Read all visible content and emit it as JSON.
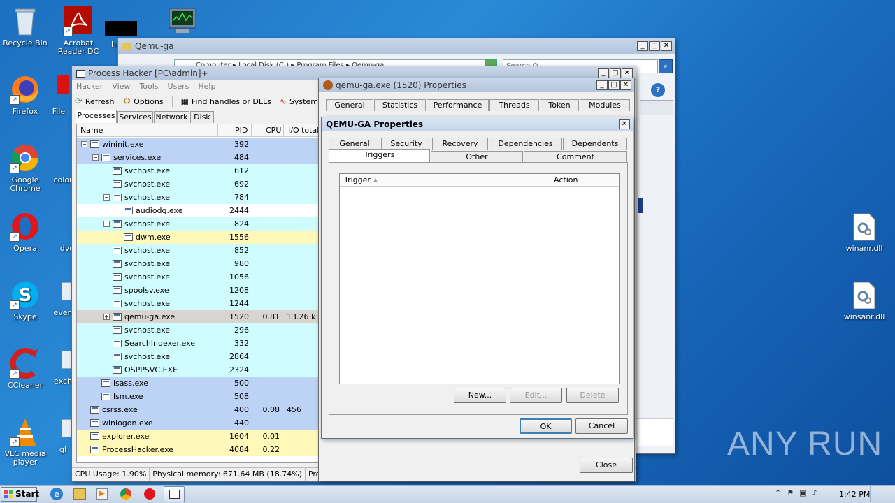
{
  "desktop": {
    "icons": [
      {
        "label": "Recycle Bin",
        "x": "recycle"
      },
      {
        "label": "Acrobat Reader DC"
      },
      {
        "label": "hi"
      },
      {
        "label": "Firefox"
      },
      {
        "label": "File"
      },
      {
        "label": "Google Chrome"
      },
      {
        "label": "color"
      },
      {
        "label": "Opera"
      },
      {
        "label": "dvd"
      },
      {
        "label": "Skype"
      },
      {
        "label": "even"
      },
      {
        "label": "CCleaner"
      },
      {
        "label": "exch"
      },
      {
        "label": "VLC media player"
      },
      {
        "label": "gl"
      },
      {
        "label": "winanr.dll"
      },
      {
        "label": "winsanr.dll"
      }
    ]
  },
  "explorer": {
    "title": "Qemu-ga",
    "path": "Computer  ▸  Local Disk (C:)  ▸  Program Files  ▸  Qemu-ga",
    "search": "Search Q..."
  },
  "ph": {
    "title": "Process Hacker [PC\\admin]+",
    "menu": [
      "Hacker",
      "View",
      "Tools",
      "Users",
      "Help"
    ],
    "toolbar": {
      "refresh": "Refresh",
      "options": "Options",
      "find": "Find handles or DLLs",
      "sysinfo": "System info"
    },
    "tabs": [
      "Processes",
      "Services",
      "Network",
      "Disk"
    ],
    "columns": {
      "name": "Name",
      "pid": "PID",
      "cpu": "CPU",
      "io": "I/O total"
    },
    "rows": [
      {
        "name": "wininit.exe",
        "pid": "392",
        "cpu": "",
        "io": ""
      },
      {
        "name": "services.exe",
        "pid": "484",
        "cpu": "",
        "io": ""
      },
      {
        "name": "svchost.exe",
        "pid": "612",
        "cpu": "",
        "io": ""
      },
      {
        "name": "svchost.exe",
        "pid": "692",
        "cpu": "",
        "io": ""
      },
      {
        "name": "svchost.exe",
        "pid": "784",
        "cpu": "",
        "io": ""
      },
      {
        "name": "audiodg.exe",
        "pid": "2444",
        "cpu": "",
        "io": ""
      },
      {
        "name": "svchost.exe",
        "pid": "824",
        "cpu": "",
        "io": ""
      },
      {
        "name": "dwm.exe",
        "pid": "1556",
        "cpu": "",
        "io": ""
      },
      {
        "name": "svchost.exe",
        "pid": "852",
        "cpu": "",
        "io": ""
      },
      {
        "name": "svchost.exe",
        "pid": "980",
        "cpu": "",
        "io": ""
      },
      {
        "name": "svchost.exe",
        "pid": "1056",
        "cpu": "",
        "io": ""
      },
      {
        "name": "spoolsv.exe",
        "pid": "1208",
        "cpu": "",
        "io": ""
      },
      {
        "name": "svchost.exe",
        "pid": "1244",
        "cpu": "",
        "io": ""
      },
      {
        "name": "qemu-ga.exe",
        "pid": "1520",
        "cpu": "0.81",
        "io": "13.26 k"
      },
      {
        "name": "svchost.exe",
        "pid": "296",
        "cpu": "",
        "io": ""
      },
      {
        "name": "SearchIndexer.exe",
        "pid": "332",
        "cpu": "",
        "io": ""
      },
      {
        "name": "svchost.exe",
        "pid": "2864",
        "cpu": "",
        "io": ""
      },
      {
        "name": "OSPPSVC.EXE",
        "pid": "2324",
        "cpu": "",
        "io": ""
      },
      {
        "name": "lsass.exe",
        "pid": "500",
        "cpu": "",
        "io": ""
      },
      {
        "name": "lsm.exe",
        "pid": "508",
        "cpu": "",
        "io": ""
      },
      {
        "name": "csrss.exe",
        "pid": "400",
        "cpu": "0.08",
        "io": "456"
      },
      {
        "name": "winlogon.exe",
        "pid": "440",
        "cpu": "",
        "io": ""
      },
      {
        "name": "explorer.exe",
        "pid": "1604",
        "cpu": "0.01",
        "io": ""
      },
      {
        "name": "ProcessHacker.exe",
        "pid": "4084",
        "cpu": "0.22",
        "io": ""
      }
    ],
    "status": {
      "cpu": "CPU Usage: 1.90%",
      "mem": "Physical memory: 671.64 MB (18.74%)",
      "proc": "Processes"
    }
  },
  "props": {
    "title": "qemu-ga.exe (1520) Properties",
    "tabs1": [
      "General",
      "Statistics",
      "Performance",
      "Threads",
      "Token",
      "Modules"
    ],
    "close": "Close"
  },
  "svc": {
    "title": "QEMU-GA Properties",
    "tabsRow1": [
      "General",
      "Security",
      "Recovery",
      "Dependencies",
      "Dependents"
    ],
    "tabsRow2": [
      "Triggers",
      "Other",
      "Comment"
    ],
    "cols": {
      "trigger": "Trigger",
      "action": "Action"
    },
    "buttons": {
      "new": "New...",
      "edit": "Edit...",
      "delete": "Delete",
      "ok": "OK",
      "cancel": "Cancel"
    }
  },
  "taskbar": {
    "start": "Start",
    "time": "1:42 PM"
  },
  "watermark": "ANY RUN"
}
